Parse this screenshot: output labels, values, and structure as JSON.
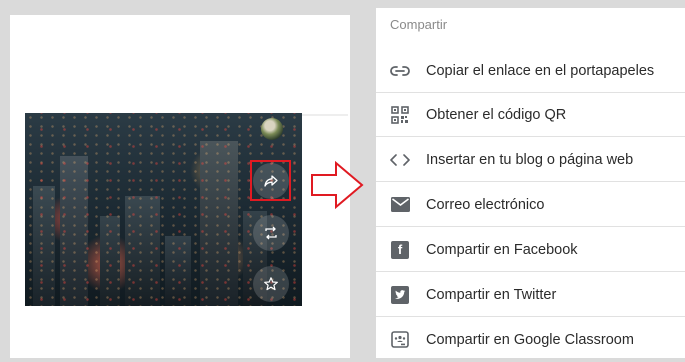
{
  "menu": {
    "title": "Compartir",
    "items": [
      {
        "label": "Copiar el enlace en el portapapeles",
        "icon": "link-icon"
      },
      {
        "label": "Obtener el código QR",
        "icon": "qr-code-icon"
      },
      {
        "label": "Insertar en tu blog o página web",
        "icon": "embed-code-icon"
      },
      {
        "label": "Correo electrónico",
        "icon": "envelope-icon"
      },
      {
        "label": "Compartir en Facebook",
        "icon": "facebook-icon",
        "glyph": "f"
      },
      {
        "label": "Compartir en Twitter",
        "icon": "twitter-icon"
      },
      {
        "label": "Compartir en Google Classroom",
        "icon": "google-classroom-icon"
      }
    ]
  },
  "video": {
    "buttons": [
      {
        "name": "share-button",
        "icon": "share-arrow-icon"
      },
      {
        "name": "repost-button",
        "icon": "repost-icon"
      },
      {
        "name": "favorite-button",
        "icon": "star-icon"
      }
    ]
  },
  "colors": {
    "highlight": "#e01a22",
    "icon_gray": "#5f6368",
    "text": "#2b2b2b",
    "title_gray": "#8a8a8a"
  }
}
